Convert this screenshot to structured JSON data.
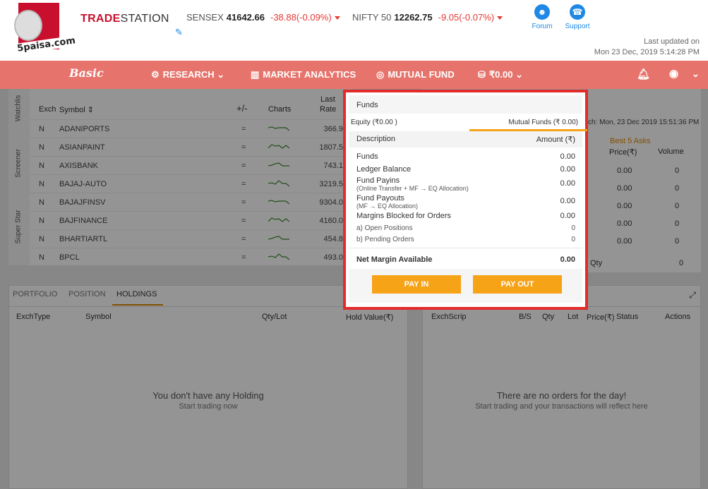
{
  "header": {
    "logo_text": "5paisa.com",
    "brand_part1": "TRADE",
    "brand_part2": "STATION",
    "sensex": {
      "name": "SENSEX",
      "value": "41642.66",
      "change": "-38.88(-0.09%)"
    },
    "nifty": {
      "name": "NIFTY 50",
      "value": "12262.75",
      "change": "-9.05(-0.07%)"
    },
    "forum_label": "Forum",
    "support_label": "Support",
    "last_updated_label": "Last updated on",
    "last_updated_value": "Mon 23 Dec, 2019  5:14:28 PM"
  },
  "nav": {
    "basic_label": "Basic",
    "research": "RESEARCH",
    "market_analytics": "MARKET ANALYTICS",
    "mutual_fund": "MUTUAL FUND",
    "balance": "₹0.00"
  },
  "watchlist": {
    "side_tabs": [
      "Watchlis",
      "Screener",
      "Super Star"
    ],
    "headers": {
      "exch": "Exch",
      "symbol": "Symbol",
      "change": "+/-",
      "charts": "Charts",
      "rate_line1": "Last",
      "rate_line2": "Rate"
    },
    "rows": [
      {
        "exch": "N",
        "symbol": "ADANIPORTS",
        "change": "=",
        "rate": "366.9"
      },
      {
        "exch": "N",
        "symbol": "ASIANPAINT",
        "change": "=",
        "rate": "1807.5"
      },
      {
        "exch": "N",
        "symbol": "AXISBANK",
        "change": "=",
        "rate": "743.1"
      },
      {
        "exch": "N",
        "symbol": "BAJAJ-AUTO",
        "change": "=",
        "rate": "3219.5"
      },
      {
        "exch": "N",
        "symbol": "BAJAJFINSV",
        "change": "=",
        "rate": "9304.0"
      },
      {
        "exch": "N",
        "symbol": "BAJFINANCE",
        "change": "=",
        "rate": "4160.0"
      },
      {
        "exch": "N",
        "symbol": "BHARTIARTL",
        "change": "=",
        "rate": "454.8"
      },
      {
        "exch": "N",
        "symbol": "BPCL",
        "change": "=",
        "rate": "493.0"
      }
    ]
  },
  "market_depth": {
    "timestamp": "ch: Mon, 23 Dec 2019 15:51:36 PM",
    "best_asks_label": "Best 5 Asks",
    "col_price": "Price(₹)",
    "col_volume": "Volume",
    "rows": [
      {
        "price": "0.00",
        "volume": "0"
      },
      {
        "price": "0.00",
        "volume": "0"
      },
      {
        "price": "0.00",
        "volume": "0"
      },
      {
        "price": "0.00",
        "volume": "0"
      },
      {
        "price": "0.00",
        "volume": "0"
      }
    ],
    "total_qty_label": "Qty",
    "total_qty_value": "0"
  },
  "holdings_panel": {
    "tabs": [
      "PORTFOLIO",
      "POSITION",
      "HOLDINGS"
    ],
    "active_tab": "HOLDINGS",
    "columns": [
      "ExchType",
      "Symbol",
      "Qty/Lot",
      "Hold Value(₹)"
    ],
    "empty_title": "You don't have any Holding",
    "empty_sub": "Start trading now"
  },
  "orders_panel": {
    "columns": [
      "ExchScrip",
      "B/S",
      "Qty",
      "Lot",
      "Price(₹)",
      "Status",
      "Actions"
    ],
    "empty_title": "There are no orders for the day!",
    "empty_sub": "Start trading and your transactions will reflect here"
  },
  "funds_popup": {
    "title": "Funds",
    "equity_tab": "Equity (₹0.00 )",
    "mf_tab": "Mutual Funds (₹ 0.00)",
    "col_description": "Description",
    "col_amount": "Amount (₹)",
    "lines": [
      {
        "label": "Funds",
        "amount": "0.00"
      },
      {
        "label": "Ledger Balance",
        "amount": "0.00"
      },
      {
        "label": "Fund Payins",
        "sub": "(Online Transfer + MF → EQ Allocation)",
        "amount": "0.00"
      },
      {
        "label": "Fund Payouts",
        "sub": "(MF → EQ Allocation)",
        "amount": "0.00"
      },
      {
        "label": "Margins Blocked for Orders",
        "amount": "0.00"
      },
      {
        "label": "a) Open Positions",
        "amount": "0"
      },
      {
        "label": "b) Pending Orders",
        "amount": "0"
      }
    ],
    "net_margin_label": "Net Margin Available",
    "net_margin_value": "0.00",
    "pay_in": "PAY IN",
    "pay_out": "PAY OUT"
  },
  "colors": {
    "brand_red": "#c8102e",
    "nav_bg": "#e6746c",
    "accent_blue": "#1e88e5",
    "button_orange": "#f7a318",
    "negative_red": "#e53935",
    "highlight_border": "#e32b2b"
  }
}
